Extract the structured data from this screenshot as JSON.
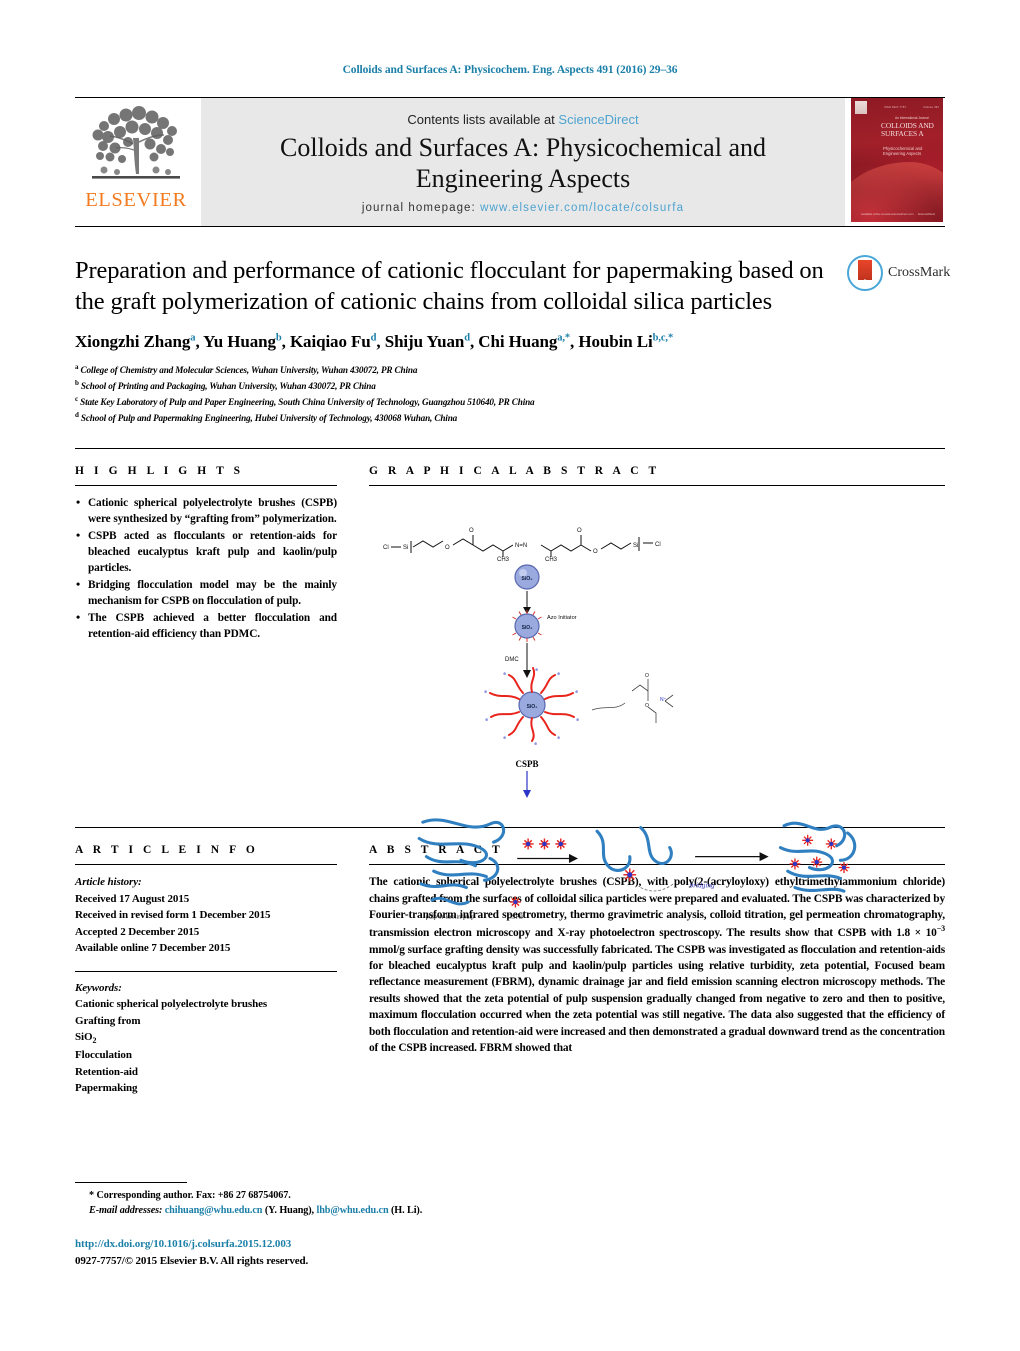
{
  "running_head": "Colloids and Surfaces A: Physicochem. Eng. Aspects 491 (2016) 29–36",
  "masthead": {
    "publisher_logo_text": "ELSEVIER",
    "contents_prefix": "Contents lists available at ",
    "contents_link": "ScienceDirect",
    "journal_title_line1": "Colloids and Surfaces A: Physicochemical and",
    "journal_title_line2": "Engineering Aspects",
    "homepage_prefix": "journal homepage: ",
    "homepage_url": "www.elsevier.com/locate/colsurfa",
    "cover": {
      "eyebrow": "An International Journal",
      "title": "COLLOIDS AND SURFACES A",
      "subtitle": "Physicochemical and Engineering Aspects",
      "top_left_note": "ISSN 0927-7757",
      "top_right_note": "Volume 491",
      "bottom_left_note": "Available online at www.sciencedirect.com",
      "bottom_right_note": "ScienceDirect"
    }
  },
  "article": {
    "title": "Preparation and performance of cationic flocculant for papermaking based on the graft polymerization of cationic chains from colloidal silica particles",
    "crossmark_label": "CrossMark",
    "authors": [
      {
        "name": "Xiongzhi Zhang",
        "sup": "a"
      },
      {
        "name": "Yu Huang",
        "sup": "b"
      },
      {
        "name": "Kaiqiao Fu",
        "sup": "d"
      },
      {
        "name": "Shiju Yuan",
        "sup": "d"
      },
      {
        "name": "Chi Huang",
        "sup": "a,*"
      },
      {
        "name": "Houbin Li",
        "sup": "b,c,*"
      }
    ],
    "affiliations": [
      {
        "marker": "a",
        "text": "College of Chemistry and Molecular Sciences, Wuhan University, Wuhan 430072, PR China"
      },
      {
        "marker": "b",
        "text": "School of Printing and Packaging, Wuhan University, Wuhan 430072, PR China"
      },
      {
        "marker": "c",
        "text": "State Key Laboratory of Pulp and Paper Engineering, South China University of Technology, Guangzhou 510640, PR China"
      },
      {
        "marker": "d",
        "text": "School of Pulp and Papermaking Engineering, Hubei University of Technology, 430068 Wuhan, China"
      }
    ]
  },
  "highlights": {
    "heading": "H I G H L I G H T S",
    "items": [
      "Cationic spherical polyelectrolyte brushes (CSPB) were synthesized by “grafting from” polymerization.",
      "CSPB acted as flocculants or retention-aids for bleached eucalyptus kraft pulp and kaolin/pulp particles.",
      "Bridging flocculation model may be the mainly mechanism for CSPB on flocculation of pulp.",
      "The CSPB achieved a better flocculation and retention-aid efficiency than PDMC."
    ]
  },
  "graphical_abstract": {
    "heading": "G R A P H I C A L   A B S T R A C T",
    "labels": {
      "initiator_particle": "SiO2",
      "silica_particle": "SiO2",
      "azo_initiator": "Azo Initiator",
      "monomer_step": "DMC",
      "product": "CSPB",
      "bridging": "bridging",
      "legend_pulp": "pulp or kaolin/pulp",
      "legend_cspb": "CSPB",
      "chlorine": "Cl",
      "oxygen": "O",
      "silicon": "Si",
      "methyl": "CH3",
      "azo_bond": "N=N"
    }
  },
  "article_info": {
    "heading": "A R T I C L E   I N F O",
    "history_label": "Article history:",
    "history": [
      "Received 17 August 2015",
      "Received in revised form 1 December 2015",
      "Accepted 2 December 2015",
      "Available online 7 December 2015"
    ],
    "keywords_label": "Keywords:",
    "keywords": [
      "Cationic spherical polyelectrolyte brushes",
      "Grafting from",
      "SiO2",
      "Flocculation",
      "Retention-aid",
      "Papermaking"
    ]
  },
  "abstract": {
    "heading": "A B S T R A C T",
    "body_part1": "The cationic spherical polyelectrolyte brushes (CSPB), with poly(2-(acryloyloxy) ethyltrimethylammonium chloride) chains grafted from the surfaces of colloidal silica particles were prepared and evaluated. The CSPB was characterized by Fourier-transform infrared spectrometry, thermo gravimetric analysis, colloid titration, gel permeation chromatography, transmission electron microscopy and X-ray photoelectron spectroscopy. The results show that CSPB with 1.8 × 10",
    "exponent": "−3",
    "body_part2": " mmol/g surface grafting density was successfully fabricated. The CSPB was investigated as flocculation and retention-aids for bleached eucalyptus kraft pulp and kaolin/pulp particles using relative turbidity, zeta potential, Focused beam reflectance measurement (FBRM), dynamic drainage jar and field emission scanning electron microscopy methods. The results showed that the zeta potential of pulp suspension gradually changed from negative to zero and then to positive, maximum flocculation occurred when the zeta potential was still negative. The data also suggested that the efficiency of both flocculation and retention-aid were increased and then demonstrated a gradual downward trend as the concentration of the CSPB increased. FBRM showed that"
  },
  "footer": {
    "corresponding_marker": "*",
    "corresponding_text": "Corresponding author. Fax: +86 27 68754067.",
    "email_label": "E-mail addresses:",
    "email1": "chihuang@whu.edu.cn",
    "email1_owner": "(Y. Huang),",
    "email2": "lhb@whu.edu.cn",
    "email2_owner": "(H. Li).",
    "doi": "http://dx.doi.org/10.1016/j.colsurfa.2015.12.003",
    "copyright": "0927-7757/© 2015 Elsevier B.V. All rights reserved."
  }
}
